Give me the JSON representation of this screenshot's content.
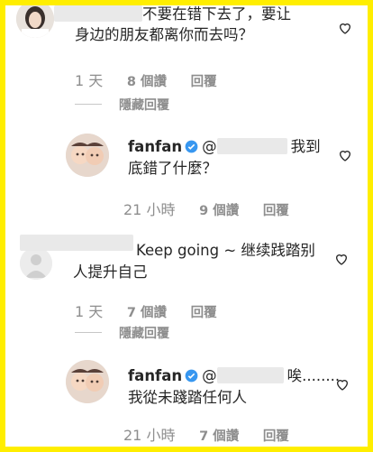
{
  "comments": [
    {
      "text_line1": "不要在错下去了，要让",
      "text_line2": "身边的朋友都离你而去吗？",
      "time": "1 天",
      "likes": "8 個讚",
      "reply": "回覆",
      "hide_replies": "隱藏回覆"
    },
    {
      "username": "fanfan",
      "mention": "@",
      "text_line1_tail": "我到",
      "text_line2": "底錯了什麼？",
      "time": "21 小時",
      "likes": "9 個讚",
      "reply": "回覆"
    },
    {
      "text_line1": "Keep going ~ 继续践踏别",
      "text_line2": "人提升自己",
      "time": "1 天",
      "likes": "7 個讚",
      "reply": "回覆",
      "hide_replies": "隱藏回覆"
    },
    {
      "username": "fanfan",
      "mention": "@",
      "text_line1_tail": "唉........",
      "text_line2": "我從未踐踏任何人",
      "time": "21 小時",
      "likes": "7 個讚",
      "reply": "回覆"
    }
  ],
  "colors": {
    "border": "#ffee00",
    "verified": "#3897f0",
    "meta": "#8e8e8e"
  }
}
